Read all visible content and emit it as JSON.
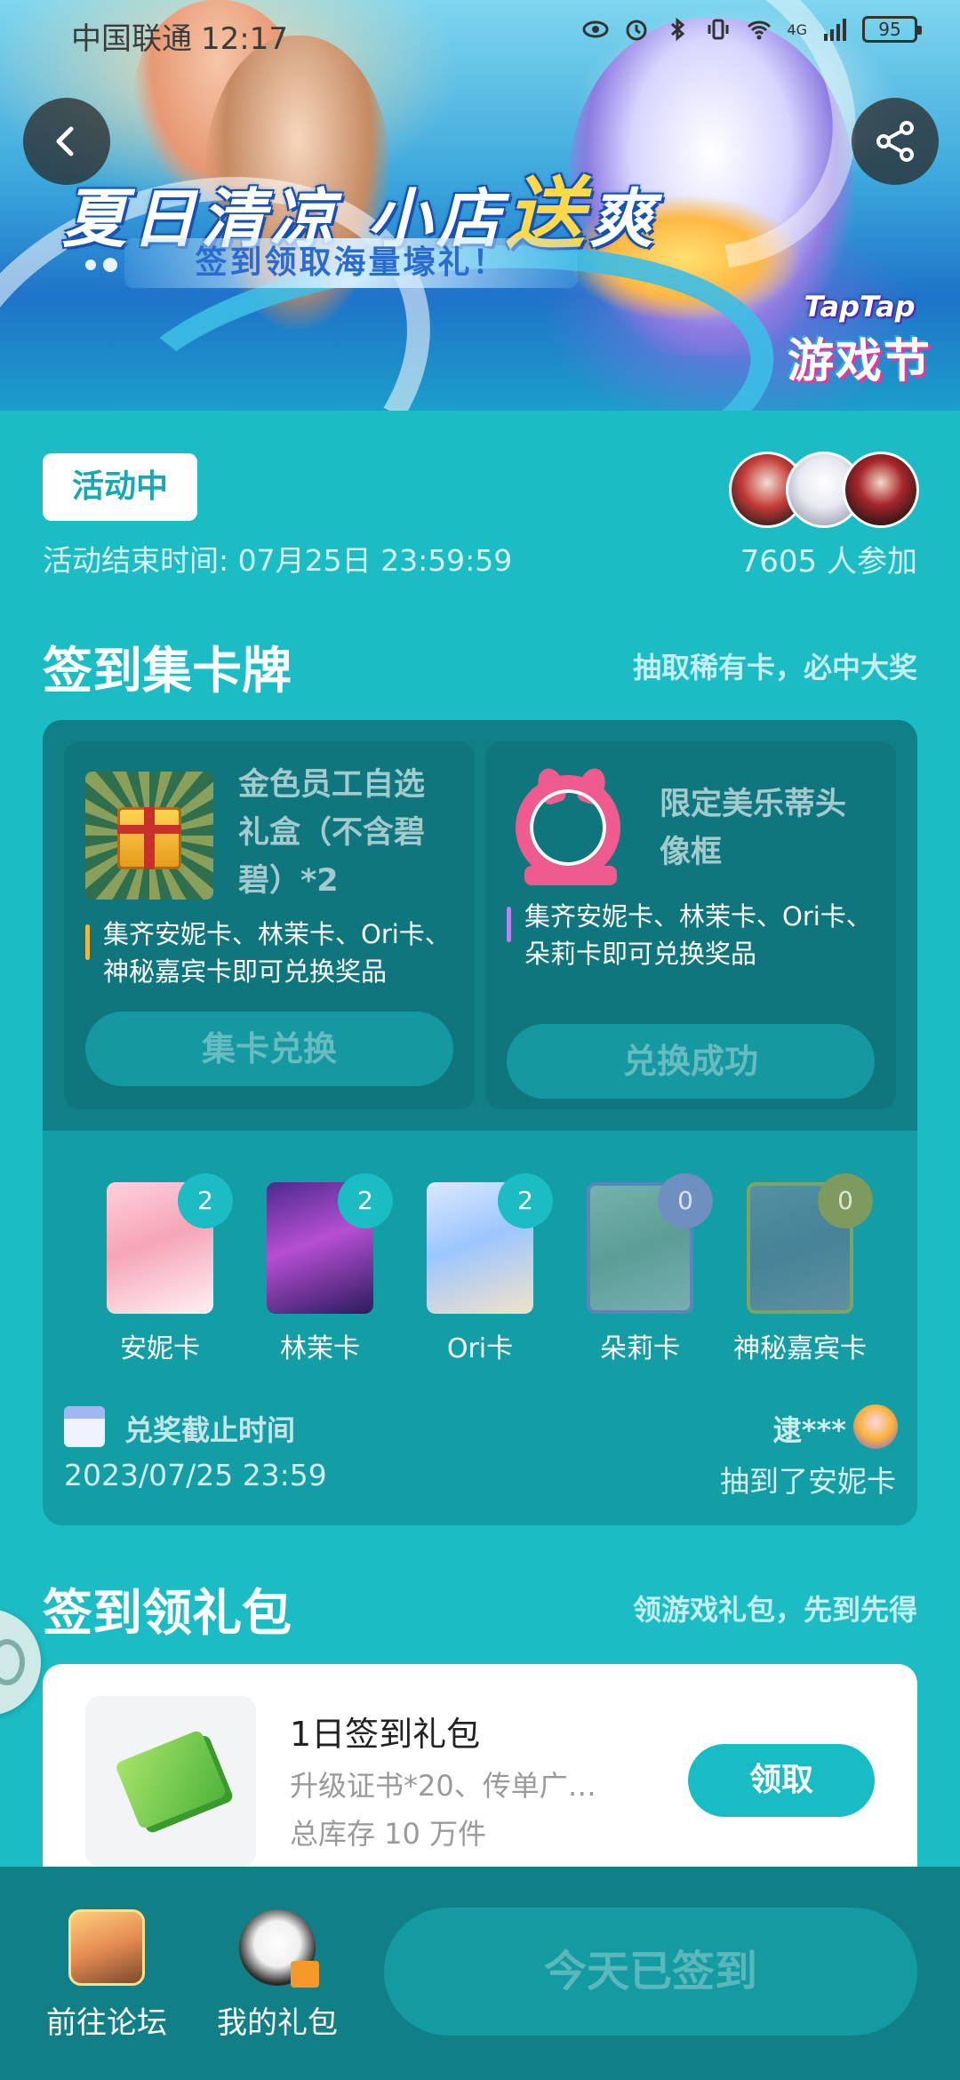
{
  "status_bar": {
    "carrier": "中国联通",
    "time": "12:17",
    "network": "4G",
    "battery": "95"
  },
  "banner": {
    "title_part1": "夏日清凉 小店",
    "title_highlight": "送",
    "title_part2": "爽",
    "subtitle": "签到领取海量壕礼！",
    "logo_line1": "TapTap",
    "logo_line2": "游戏节"
  },
  "activity": {
    "status_badge": "活动中",
    "end_time": "活动结束时间: 07月25日 23:59:59",
    "participants": "7605 人参加"
  },
  "collect_section": {
    "title": "签到集卡牌",
    "tip": "抽取稀有卡，必中大奖",
    "rewards": [
      {
        "name": "金色员工自选礼盒（不含碧碧）*2",
        "condition": "集齐安妮卡、林茉卡、Ori卡、神秘嘉宾卡即可兑换奖品",
        "button": "集卡兑换"
      },
      {
        "name": "限定美乐蒂头像框",
        "condition": "集齐安妮卡、林茉卡、Ori卡、朵莉卡即可兑换奖品",
        "button": "兑换成功"
      }
    ],
    "cards": [
      {
        "label": "安妮卡",
        "count": "2"
      },
      {
        "label": "林茉卡",
        "count": "2"
      },
      {
        "label": "Ori卡",
        "count": "2"
      },
      {
        "label": "朵莉卡",
        "count": "0"
      },
      {
        "label": "神秘嘉宾卡",
        "count": "0"
      }
    ],
    "deadline_label": "兑奖截止时间",
    "deadline_time": "2023/07/25 23:59",
    "winner_name": "逮***",
    "winner_msg": "抽到了安妮卡"
  },
  "gift_section": {
    "title": "签到领礼包",
    "tip": "领游戏礼包，先到先得",
    "gift": {
      "title": "1日签到礼包",
      "desc": "升级证书*20、传单广…",
      "stock": "总库存 10 万件",
      "button": "领取"
    }
  },
  "bottom_bar": {
    "forum": "前往论坛",
    "my_gifts": "我的礼包",
    "signed_button": "今天已签到"
  },
  "colors": {
    "background": "#1bbcc4",
    "panel": "#139ea6",
    "panel_dark": "#117f86",
    "accent_button": "#18bcc4"
  }
}
